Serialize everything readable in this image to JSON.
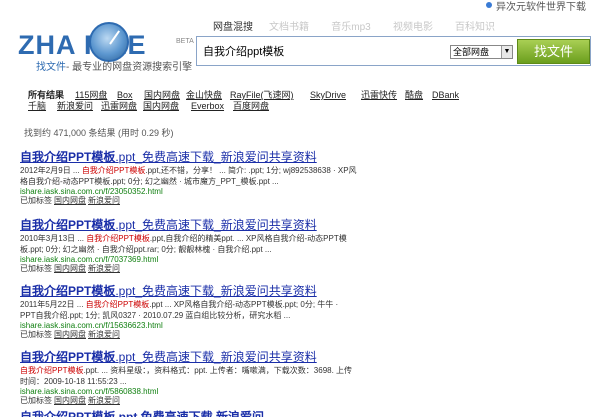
{
  "top_right": {
    "text": "异次元软件世界下载"
  },
  "logo": {
    "brand": "ZHA FILE",
    "beta": "BETA",
    "tagline_link": "找文件",
    "tagline_rest": "- 最专业的网盘资源搜索引擎"
  },
  "tabs": [
    {
      "label": "网盘混搜",
      "active": true
    },
    {
      "label": "文档书籍",
      "active": false
    },
    {
      "label": "音乐mp3",
      "active": false
    },
    {
      "label": "视频电影",
      "active": false
    },
    {
      "label": "百科知识",
      "active": false
    }
  ],
  "search": {
    "value": "自我介绍ppt模板",
    "scope": "全部网盘",
    "button": "找文件"
  },
  "categories": {
    "row1": [
      "所有结果",
      "115网盘",
      "Box",
      "国内网盘",
      "金山快盘",
      "RayFile(飞速网)",
      "SkyDrive",
      "迅雷快传",
      "酷盘",
      "DBank"
    ],
    "row2": [
      "千脑",
      "新浪爱问",
      "迅雷网盘",
      "国内网盘",
      "Everbox",
      "百度网盘"
    ]
  },
  "result_count": "找到约 471,000 条结果 (用时 0.29 秒)",
  "results": [
    {
      "title_bold": "自我介绍PPT模板",
      "title_rest": ".ppt_免费高速下载_新浪爱问共享资料",
      "desc1_pre": "2012年2月9日 ... ",
      "desc1_hl": "自我介绍PPT模板",
      "desc1_post": ".ppt,还不错，分享！ ... 简介: .ppt; 1分; wj892538638 · XP风",
      "desc2": "格自我介绍-动态PPT模板.ppt; 0分; 幻之幽然 · 城市魔方_PPT_模板.ppt ...",
      "url": "ishare.iask.sina.com.cn/f/23050352.html",
      "tags_label": "已加标签",
      "tag1": "国内网盘",
      "tag2": "新浪爱问"
    },
    {
      "title_bold": "自我介绍PPT模板",
      "title_rest": ".ppt_免费高速下载_新浪爱问共享资料",
      "desc1_pre": "2010年3月13日 ... ",
      "desc1_hl": "自我介绍PPT模板",
      "desc1_post": ".ppt,自我介绍的精美ppt. ... XP风格自我介绍-动态PPT模",
      "desc2": "板.ppt; 0分; 幻之幽然 · 自我介绍ppt.rar; 0分; 靓靓林槐 · 自我介绍.ppt ...",
      "url": "ishare.iask.sina.com.cn/f/7037369.html",
      "tags_label": "已加标签",
      "tag1": "国内网盘",
      "tag2": "新浪爱问"
    },
    {
      "title_bold": "自我介绍PPT模板",
      "title_rest": ".ppt_免费高速下载_新浪爱问共享资料",
      "desc1_pre": "2011年5月22日 ... ",
      "desc1_hl": "自我介绍PPT模板",
      "desc1_post": ".ppt ... XP风格自我介绍-动态PPT模板.ppt; 0分; 牛牛 ·",
      "desc2": "PPT自我介绍.ppt; 1分; 凯风0327 · 2010.07.29 蓝白组比较分析，研究水稻 ...",
      "url": "ishare.iask.sina.com.cn/f/15636623.html",
      "tags_label": "已加标签",
      "tag1": "国内网盘",
      "tag2": "新浪爱问"
    },
    {
      "title_bold": "自我介绍PPT模板",
      "title_rest": ".ppt_免费高速下载_新浪爱问共享资料",
      "desc1_pre": "",
      "desc1_hl": "自我介绍PPT模板",
      "desc1_post": ".ppt. ... 资料星级：，资料格式：ppt. 上传者：嘴嗽满，下载次数：3698. 上传",
      "desc2": "时间：2009-10-18 11:55:23 ...",
      "url": "ishare.iask.sina.com.cn/f/5860838.html",
      "tags_label": "已加标签",
      "tag1": "国内网盘",
      "tag2": "新浪爱问"
    }
  ],
  "cut_title": "自我介绍PPT模板 ppt 免费高速下载 新浪爱问"
}
